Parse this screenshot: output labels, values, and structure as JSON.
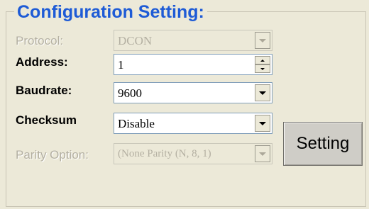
{
  "group": {
    "title": "Configuration Setting:"
  },
  "fields": {
    "protocol": {
      "label": "Protocol:",
      "value": "DCON",
      "enabled": false
    },
    "address": {
      "label": "Address:",
      "value": "1",
      "enabled": true
    },
    "baudrate": {
      "label": "Baudrate:",
      "value": "9600",
      "enabled": true
    },
    "checksum": {
      "label": "Checksum",
      "value": "Disable",
      "enabled": true
    },
    "parity": {
      "label": "Parity Option:",
      "value": "(None Parity (N, 8, 1)",
      "enabled": false
    }
  },
  "setting_button": {
    "label": "Setting"
  },
  "icons": {
    "dropdown": "chevron-down-icon",
    "spin_up": "arrow-up-icon",
    "spin_down": "arrow-down-icon"
  }
}
